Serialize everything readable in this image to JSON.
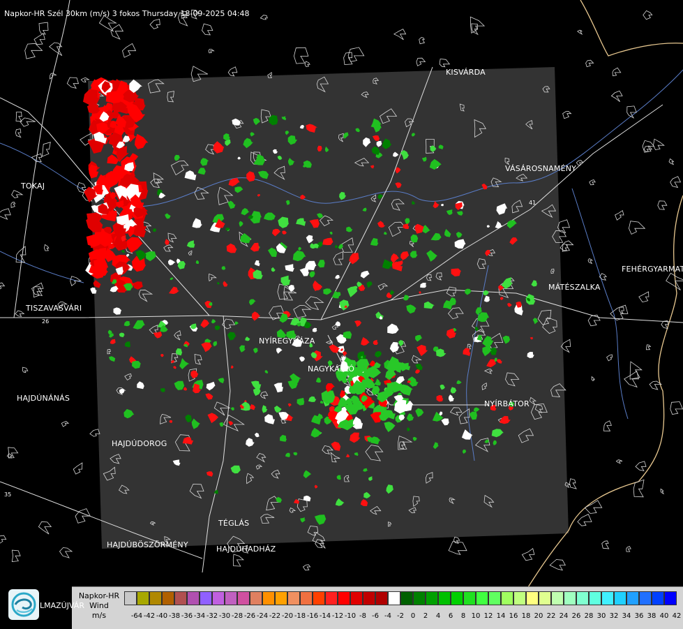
{
  "header": {
    "title": "Napkor-HR Szél 30km (m/s) 3 fokos Thursday 18-09-2025 04:48"
  },
  "cities": [
    {
      "name": "KISVÁRDA",
      "key": "kisvarda"
    },
    {
      "name": "VÁSÁROSNAMÉNY",
      "key": "vasarosnameny"
    },
    {
      "name": "TOKAJ",
      "key": "tokaj"
    },
    {
      "name": "FEHÉRGYARMAT",
      "key": "fehergyarmat"
    },
    {
      "name": "MÁTÉSZALKA",
      "key": "mateszalka"
    },
    {
      "name": "TISZAVASVÁRI",
      "key": "tiszavasvari"
    },
    {
      "name": "NYÍREGYHÁZA",
      "key": "nyiregyhaza"
    },
    {
      "name": "NAGYKÁLLÓ",
      "key": "nagykallo"
    },
    {
      "name": "HAJDÚNÁNÁS",
      "key": "hajdunanas"
    },
    {
      "name": "NYÍRBÁTOR",
      "key": "nyirbator"
    },
    {
      "name": "HAJDÚDOROG",
      "key": "hajdudorog"
    },
    {
      "name": "TÉGLÁS",
      "key": "teglas"
    },
    {
      "name": "HAJDÚBÖSZÖRMÉNY",
      "key": "hajduboszormeny"
    },
    {
      "name": "HAJDÚHADHÁZ",
      "key": "hajduhadhaz"
    },
    {
      "name": "LMAZÚJVÁR",
      "key": "logo_town"
    }
  ],
  "roads": [
    "26",
    "41",
    "35"
  ],
  "legend": {
    "line1": "Napkor-HR",
    "line2": "Wind",
    "line3": "m/s",
    "swatches": [
      "#c8c8c8",
      "#a8a800",
      "#b08800",
      "#b06000",
      "#b05050",
      "#b050b0",
      "#9060ff",
      "#c060e0",
      "#c060c0",
      "#d050a0",
      "#e08060",
      "#ff9000",
      "#ffa000",
      "#f09060",
      "#f07040",
      "#ff4000",
      "#ff2020",
      "#ff0000",
      "#e00000",
      "#c00000",
      "#b00000",
      "#ffffff",
      "#006000",
      "#008000",
      "#00a000",
      "#00c000",
      "#00d000",
      "#20e020",
      "#40ff40",
      "#60ff60",
      "#a0ff60",
      "#c0ff80",
      "#ffff80",
      "#e0ff90",
      "#c0ffb0",
      "#a0ffc0",
      "#80ffd0",
      "#60ffe0",
      "#40f0ff",
      "#20d0ff",
      "#20a0ff",
      "#2070ff",
      "#0040ff",
      "#0000ff"
    ],
    "ticks": [
      "-64",
      "-42",
      "-40",
      "-38",
      "-36",
      "-34",
      "-32",
      "-30",
      "-28",
      "-26",
      "-24",
      "-22",
      "-20",
      "-18",
      "-16",
      "-14",
      "-12",
      "-10",
      "-8",
      "-6",
      "-4",
      "-2",
      "0",
      "2",
      "4",
      "6",
      "8",
      "10",
      "12",
      "14",
      "16",
      "18",
      "20",
      "22",
      "24",
      "26",
      "28",
      "30",
      "32",
      "34",
      "36",
      "38",
      "40",
      "42"
    ]
  }
}
